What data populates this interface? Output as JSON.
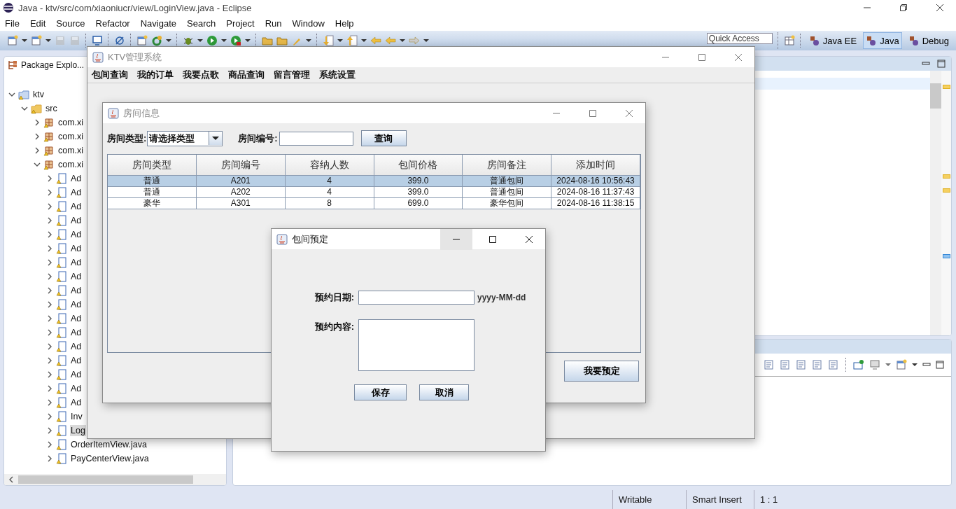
{
  "window": {
    "title": "Java - ktv/src/com/xiaoniucr/view/LoginView.java - Eclipse"
  },
  "menu": [
    "File",
    "Edit",
    "Source",
    "Refactor",
    "Navigate",
    "Search",
    "Project",
    "Run",
    "Window",
    "Help"
  ],
  "quick_access": {
    "placeholder": "Quick Access"
  },
  "perspectives": [
    {
      "label": "Java EE",
      "selected": false
    },
    {
      "label": "Java",
      "selected": true
    },
    {
      "label": "Debug",
      "selected": false
    }
  ],
  "package_explorer": {
    "title": "Package Explo...",
    "tree": [
      {
        "label": "ktv",
        "kind": "project",
        "expanded": true,
        "selected": false,
        "children": [
          {
            "label": "src",
            "kind": "folder",
            "expanded": true,
            "selected": false,
            "children": [
              {
                "label": "com.xi",
                "kind": "package",
                "expanded": false,
                "selected": false
              },
              {
                "label": "com.xi",
                "kind": "package",
                "expanded": false,
                "selected": false
              },
              {
                "label": "com.xi",
                "kind": "package",
                "expanded": false,
                "selected": false
              },
              {
                "label": "com.xi",
                "kind": "package",
                "expanded": true,
                "selected": false,
                "children": [
                  {
                    "label": "Ad",
                    "kind": "file",
                    "expanded": false,
                    "selected": false
                  },
                  {
                    "label": "Ad",
                    "kind": "file",
                    "expanded": false,
                    "selected": false
                  },
                  {
                    "label": "Ad",
                    "kind": "file",
                    "expanded": false,
                    "selected": false
                  },
                  {
                    "label": "Ad",
                    "kind": "file",
                    "expanded": false,
                    "selected": false
                  },
                  {
                    "label": "Ad",
                    "kind": "file",
                    "expanded": false,
                    "selected": false
                  },
                  {
                    "label": "Ad",
                    "kind": "file",
                    "expanded": false,
                    "selected": false
                  },
                  {
                    "label": "Ad",
                    "kind": "file",
                    "expanded": false,
                    "selected": false
                  },
                  {
                    "label": "Ad",
                    "kind": "file",
                    "expanded": false,
                    "selected": false
                  },
                  {
                    "label": "Ad",
                    "kind": "file",
                    "expanded": false,
                    "selected": false
                  },
                  {
                    "label": "Ad",
                    "kind": "file",
                    "expanded": false,
                    "selected": false
                  },
                  {
                    "label": "Ad",
                    "kind": "file",
                    "expanded": false,
                    "selected": false
                  },
                  {
                    "label": "Ad",
                    "kind": "file",
                    "expanded": false,
                    "selected": false
                  },
                  {
                    "label": "Ad",
                    "kind": "file",
                    "expanded": false,
                    "selected": false
                  },
                  {
                    "label": "Ad",
                    "kind": "file",
                    "expanded": false,
                    "selected": false
                  },
                  {
                    "label": "Ad",
                    "kind": "file",
                    "expanded": false,
                    "selected": false
                  },
                  {
                    "label": "Ad",
                    "kind": "file",
                    "expanded": false,
                    "selected": false
                  },
                  {
                    "label": "Ad",
                    "kind": "file",
                    "expanded": false,
                    "selected": false
                  },
                  {
                    "label": "Inv",
                    "kind": "file",
                    "expanded": false,
                    "selected": false
                  },
                  {
                    "label": "Log",
                    "kind": "file",
                    "expanded": false,
                    "selected": true
                  },
                  {
                    "label": "OrderItemView.java",
                    "kind": "file",
                    "expanded": false,
                    "selected": false
                  },
                  {
                    "label": "PayCenterView.java",
                    "kind": "file",
                    "expanded": false,
                    "selected": false
                  }
                ]
              }
            ]
          }
        ]
      }
    ]
  },
  "status_bar": [
    "Writable",
    "Smart Insert",
    "1 : 1"
  ],
  "ktv_window": {
    "title": "KTV管理系统",
    "active": false,
    "menu": [
      "包间查询",
      "我的订单",
      "我要点歌",
      "商品查询",
      "留言管理",
      "系统设置"
    ]
  },
  "room_window": {
    "title": "房间信息",
    "active": false,
    "type_label": "房间类型:",
    "type_value": "请选择类型",
    "number_label": "房间编号:",
    "search_button": "查询",
    "table": {
      "columns": [
        "房间类型",
        "房间编号",
        "容纳人数",
        "包间价格",
        "房间备注",
        "添加时间"
      ],
      "rows": [
        {
          "cells": [
            "普通",
            "A201",
            "4",
            "399.0",
            "普通包间",
            "2024-08-16 10:56:43"
          ],
          "selected": true
        },
        {
          "cells": [
            "普通",
            "A202",
            "4",
            "399.0",
            "普通包间",
            "2024-08-16 11:37:43"
          ],
          "selected": false
        },
        {
          "cells": [
            "豪华",
            "A301",
            "8",
            "699.0",
            "豪华包间",
            "2024-08-16 11:38:15"
          ],
          "selected": false
        }
      ]
    },
    "book_button": "我要预定"
  },
  "booking_dialog": {
    "title": "包间预定",
    "active": true,
    "minimize_hovered": true,
    "date_label": "预约日期:",
    "date_hint": "yyyy-MM-dd",
    "content_label": "预约内容:",
    "buttons": [
      "保存",
      "取消"
    ]
  }
}
